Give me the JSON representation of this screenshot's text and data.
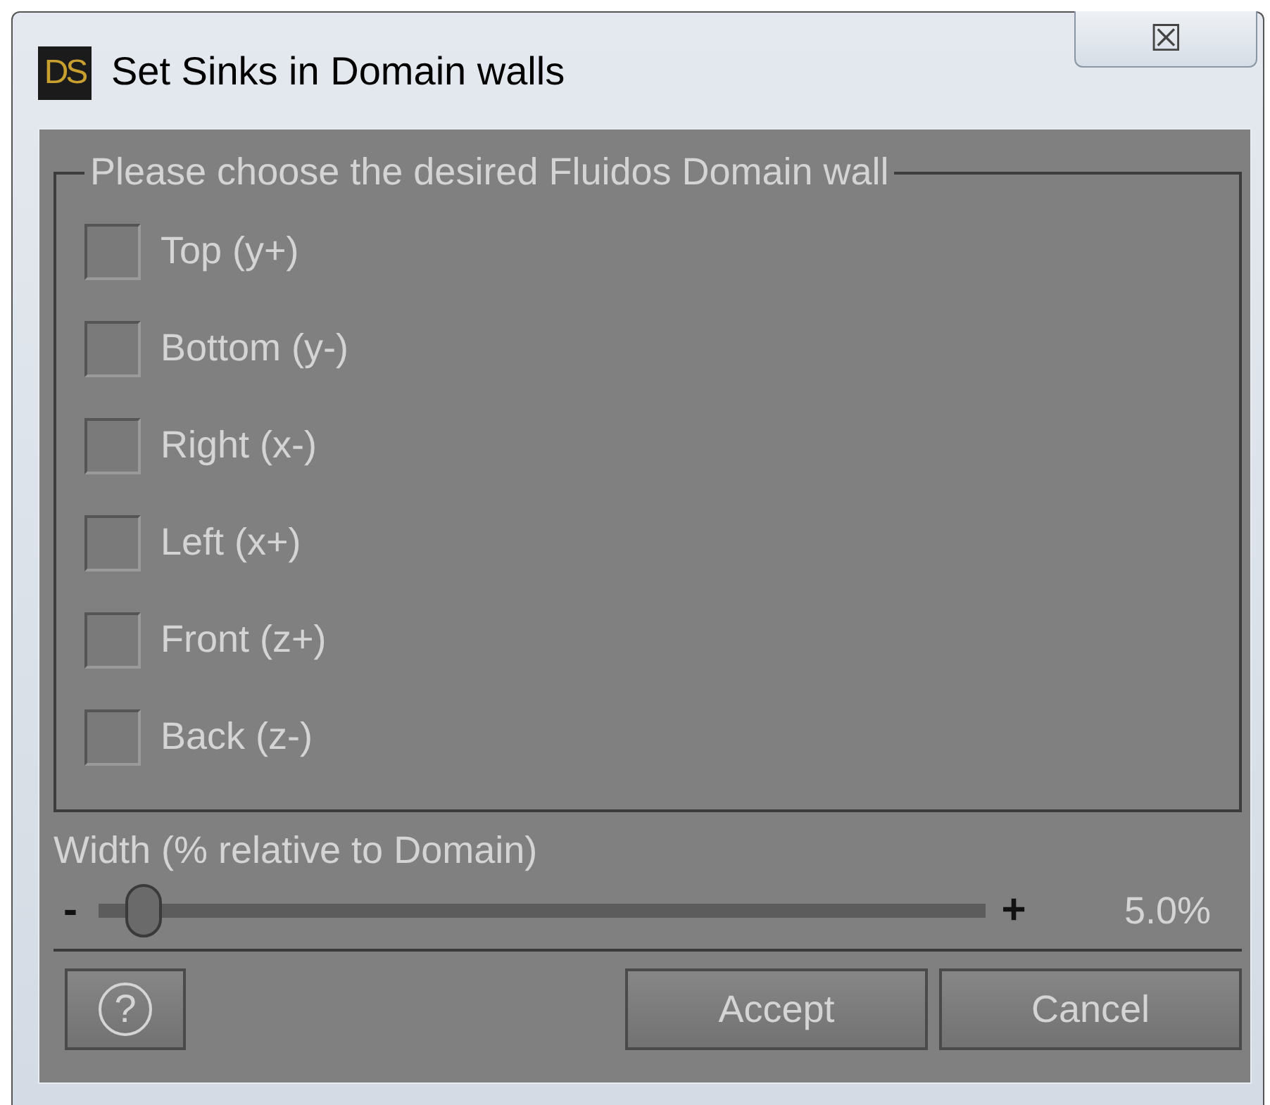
{
  "window": {
    "title": "Set Sinks in Domain walls",
    "logo": "DS",
    "close": "☒"
  },
  "group": {
    "legend": "Please choose the desired Fluidos Domain wall",
    "options": [
      {
        "label": "Top (y+)",
        "checked": false
      },
      {
        "label": "Bottom (y-)",
        "checked": false
      },
      {
        "label": "Right (x-)",
        "checked": false
      },
      {
        "label": "Left (x+)",
        "checked": false
      },
      {
        "label": "Front (z+)",
        "checked": false
      },
      {
        "label": "Back (z-)",
        "checked": false
      }
    ]
  },
  "width": {
    "label": "Width (% relative to Domain)",
    "minus": "-",
    "plus": "+",
    "level": 0.05,
    "reading": "5.0%"
  },
  "buttons": [
    {
      "kind": "help",
      "label": "?"
    },
    {
      "kind": "text",
      "label": "Accept"
    },
    {
      "kind": "text",
      "label": "Cancel"
    }
  ]
}
